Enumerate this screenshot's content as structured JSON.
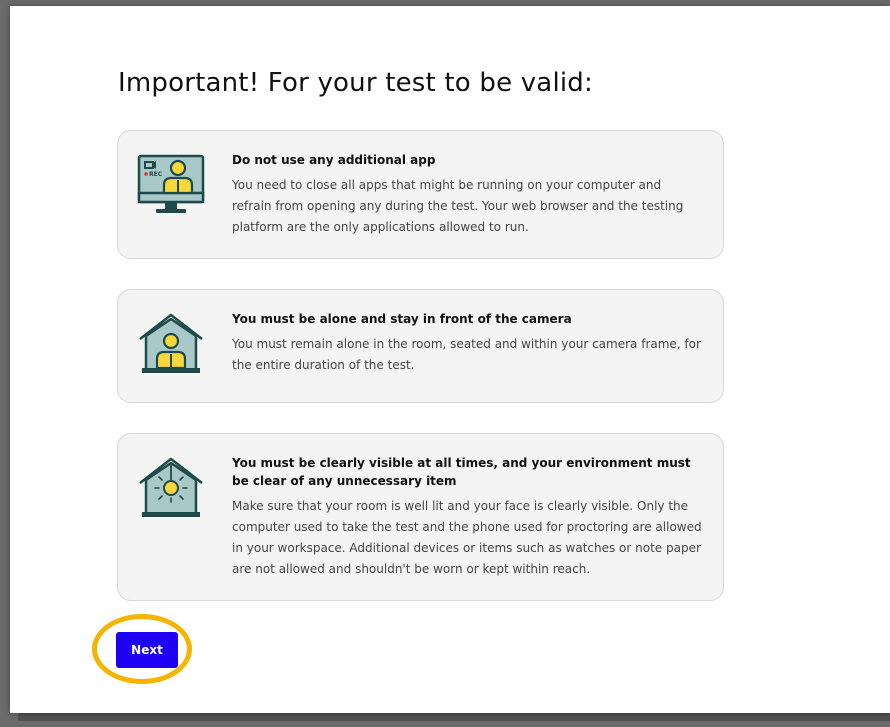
{
  "heading": "Important! For your test to be valid:",
  "cards": [
    {
      "icon": "monitor-recording-icon",
      "heading": "Do not use any additional app",
      "body": "You need to close all apps that might be running on your computer and refrain from opening any during the test. Your web browser and the testing platform are the only applications allowed to run.",
      "rec_label": "REC"
    },
    {
      "icon": "person-alone-house-icon",
      "heading": "You must be alone and stay in front of the camera",
      "body": "You must remain alone in the room, seated and within your camera frame, for the entire duration of the test."
    },
    {
      "icon": "lit-room-icon",
      "heading": "You must be clearly visible at all times, and your environment must be clear of any unnecessary item",
      "body": "Make sure that your room is well lit and your face is clearly visible. Only the computer used to take the test and the phone used for proctoring are allowed in your workspace. Additional devices or items such as watches or note paper are not allowed and shouldn't be worn or kept within reach."
    }
  ],
  "next_button": {
    "label": "Next"
  },
  "colors": {
    "accent_button": "#1f00f5",
    "highlight_ring": "#f5b400",
    "icon_teal": "#1f4a4c",
    "icon_fill": "#a9c8c8",
    "icon_yellow": "#f7d73a",
    "rec_red": "#e0312b"
  }
}
